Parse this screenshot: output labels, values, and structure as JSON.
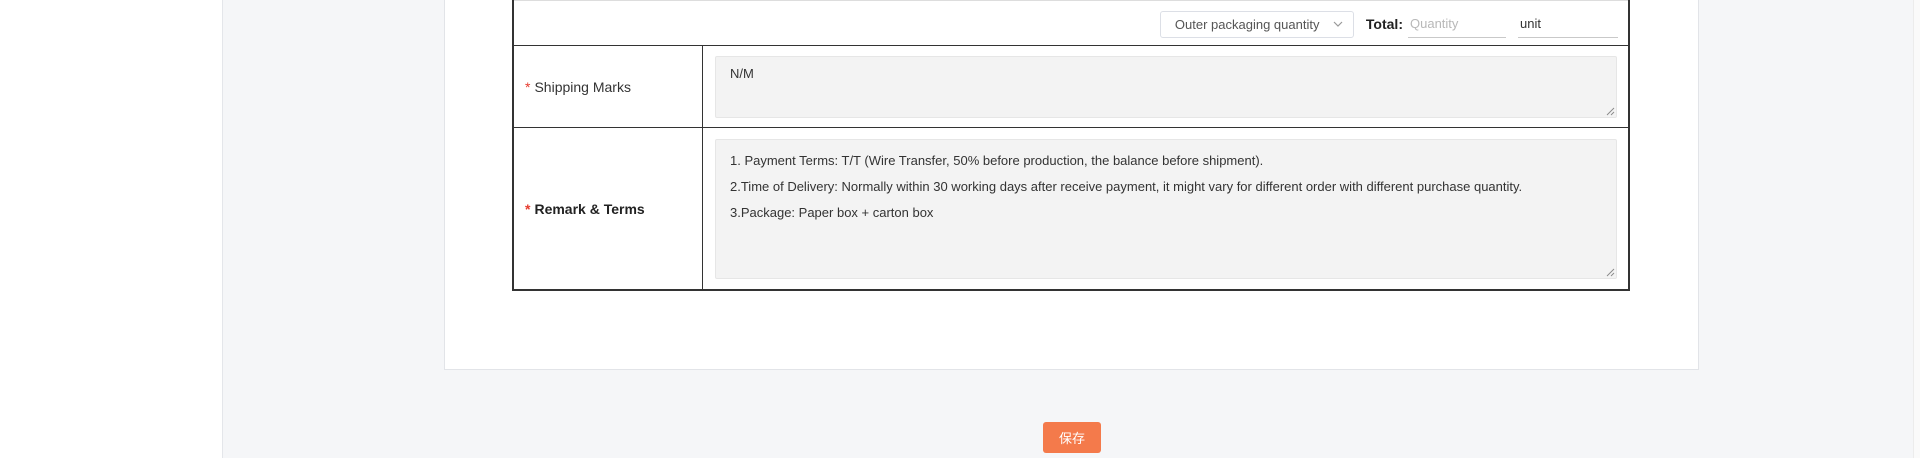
{
  "totals": {
    "select_value": "Outer packaging quantity",
    "total_label": "Total:",
    "quantity_placeholder": "Quantity",
    "quantity_value": "",
    "unit_value": "unit"
  },
  "shipping": {
    "required_mark": "*",
    "label": "Shipping Marks",
    "value": "N/M"
  },
  "remark": {
    "required_mark": "*",
    "label": "Remark & Terms",
    "lines": [
      "1. Payment Terms:  T/T (Wire Transfer, 50% before production, the balance before shipment).",
      "2.Time of Delivery:  Normally within 30 working days after receive payment, it might vary for different order with different purchase quantity.",
      "3.Package: Paper box + carton box"
    ]
  },
  "actions": {
    "save_label": "保存"
  },
  "colors": {
    "required": "#e63b2e",
    "save_button": "#f47a4b",
    "textarea_bg": "#f3f3f3"
  }
}
